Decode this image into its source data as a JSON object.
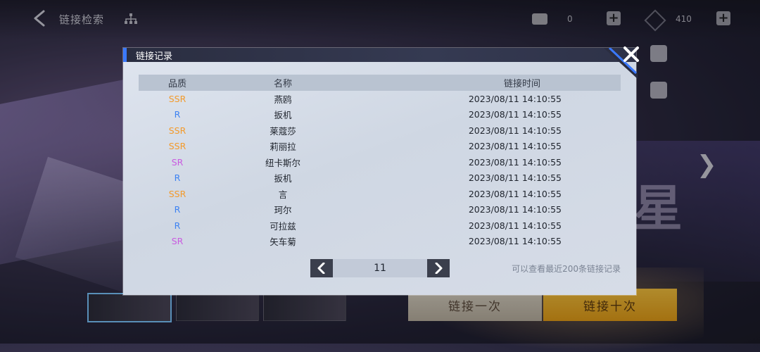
{
  "header": {
    "title": "链接检索",
    "resource1_count": "0",
    "resource2_count": "410"
  },
  "background": {
    "draw_once_label": "链接一次",
    "draw_ten_label": "链接十次",
    "big_glyph": "星"
  },
  "dialog": {
    "title": "链接记录",
    "columns": {
      "quality": "品质",
      "name": "名称",
      "time": "链接时间"
    },
    "rows": [
      {
        "quality": "SSR",
        "name": "燕鸥",
        "time": "2023/08/11 14:10:55"
      },
      {
        "quality": "R",
        "name": "扳机",
        "time": "2023/08/11 14:10:55"
      },
      {
        "quality": "SSR",
        "name": "莱蔻莎",
        "time": "2023/08/11 14:10:55"
      },
      {
        "quality": "SSR",
        "name": "莉丽拉",
        "time": "2023/08/11 14:10:55"
      },
      {
        "quality": "SR",
        "name": "纽卡斯尔",
        "time": "2023/08/11 14:10:55"
      },
      {
        "quality": "R",
        "name": "扳机",
        "time": "2023/08/11 14:10:55"
      },
      {
        "quality": "SSR",
        "name": "言",
        "time": "2023/08/11 14:10:55"
      },
      {
        "quality": "R",
        "name": "珂尔",
        "time": "2023/08/11 14:10:55"
      },
      {
        "quality": "R",
        "name": "可拉兹",
        "time": "2023/08/11 14:10:55"
      },
      {
        "quality": "SR",
        "name": "矢车菊",
        "time": "2023/08/11 14:10:55"
      }
    ],
    "page": "11",
    "hint": "可以查看最近200条链接记录"
  },
  "colors": {
    "SSR": "#f39a2b",
    "SR": "#c95be0",
    "R": "#3d82f2",
    "accent": "#3a79ff"
  }
}
